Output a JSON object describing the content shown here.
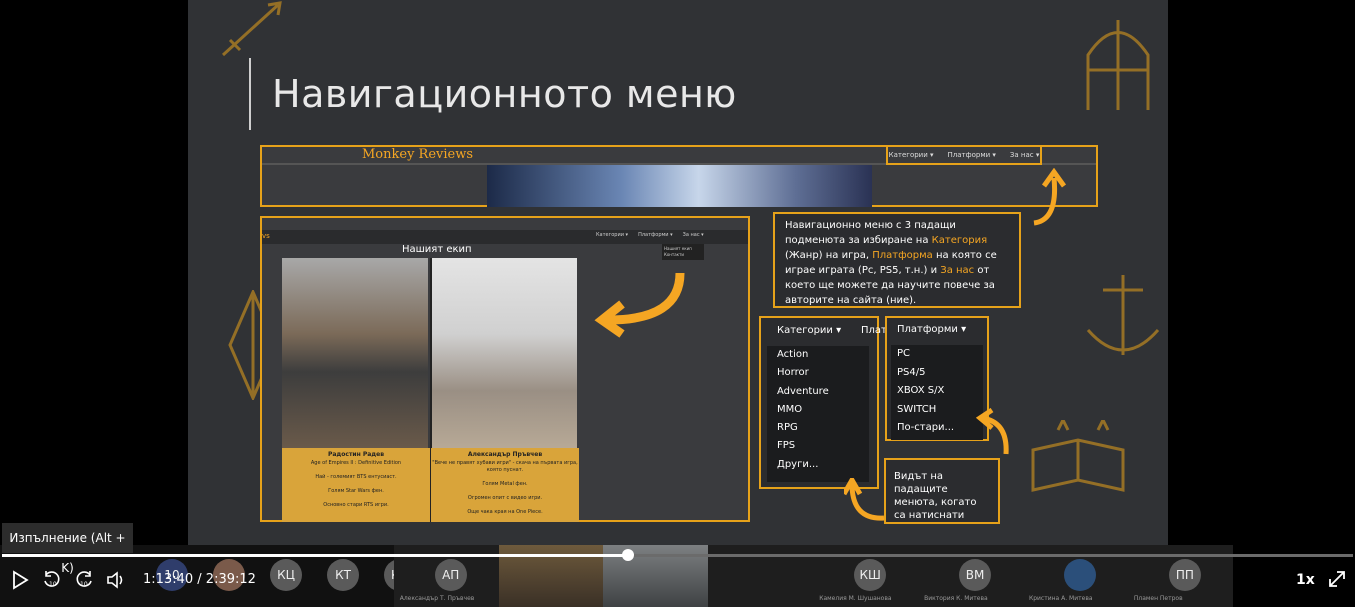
{
  "slide": {
    "title": "Навигационното меню",
    "site_logo": "Monkey Reviews",
    "header_menu": [
      "Категории ▾",
      "Платформи ▾",
      "За нас ▾"
    ],
    "team_nav": [
      "Категории ▾",
      "Платформи ▾",
      "За нас ▾"
    ],
    "team_dropdown": [
      "Нашият екип",
      "Контакти"
    ],
    "team_logo_fragment": "vs",
    "team_heading": "Нашият екип",
    "members": [
      {
        "name": "Радостин Радев",
        "lines": "Age of Empires II : Definitive Edition\n\nНай - големият BTS ентусиаст.\n\nГолям Star Wars фен.\n\nОсновно стари RTS игри."
      },
      {
        "name": "Александър Пръвчев",
        "lines": "\"Вече не правят хубави игри\" - скача на първата игра,\nкоято пуснат.\n\nГолям Metal фен.\n\nОгромен опит с видео игри.\n\nОще чака края на One Piece."
      }
    ],
    "description": {
      "part1": "Навигационно меню с 3 падащи подменюта за избиране на ",
      "cat": "Категория",
      "part2": " (Жанр) на игра, ",
      "plat": "Платформа",
      "part3": " на която се играе играта (Pc, PS5, т.н.) и ",
      "about": "За нас",
      "part4": " от което ще можете да научите повече за авторите на сайта (ние)."
    },
    "categories_head": "Категории ▾",
    "categories_head_cut": "Плат",
    "categories": [
      "Action",
      "Horror",
      "Adventure",
      "MMO",
      "RPG",
      "FPS",
      "Други..."
    ],
    "platforms_head": "Платформи ▾",
    "platforms": [
      "PC",
      "PS4/5",
      "XBOX S/X",
      "SWITCH",
      "По-стари..."
    ],
    "dropdown_note": "Видът на падащите менюта, когато са натиснати"
  },
  "player": {
    "tooltip": "Изпълнение (Alt + K)",
    "current_time": "1:13:40",
    "separator": "/",
    "total_time": "2:39:12",
    "speed": "1x",
    "progress": 0.463
  },
  "participants": [
    {
      "initials": "10",
      "name": ""
    },
    {
      "initials": "",
      "name": ""
    },
    {
      "initials": "КЦ",
      "name": ""
    },
    {
      "initials": "КТ",
      "name": ""
    },
    {
      "initials": "КД",
      "name": ""
    },
    {
      "initials": "АП",
      "name": "Александър Т. Пръвчев"
    },
    {
      "initials": "КШ",
      "name": "Камелия М. Шушанова"
    },
    {
      "initials": "ВМ",
      "name": "Виктория К. Митева"
    },
    {
      "initials": "",
      "name": "Кристина А. Митева"
    },
    {
      "initials": "ПП",
      "name": "Пламен Петров"
    }
  ]
}
